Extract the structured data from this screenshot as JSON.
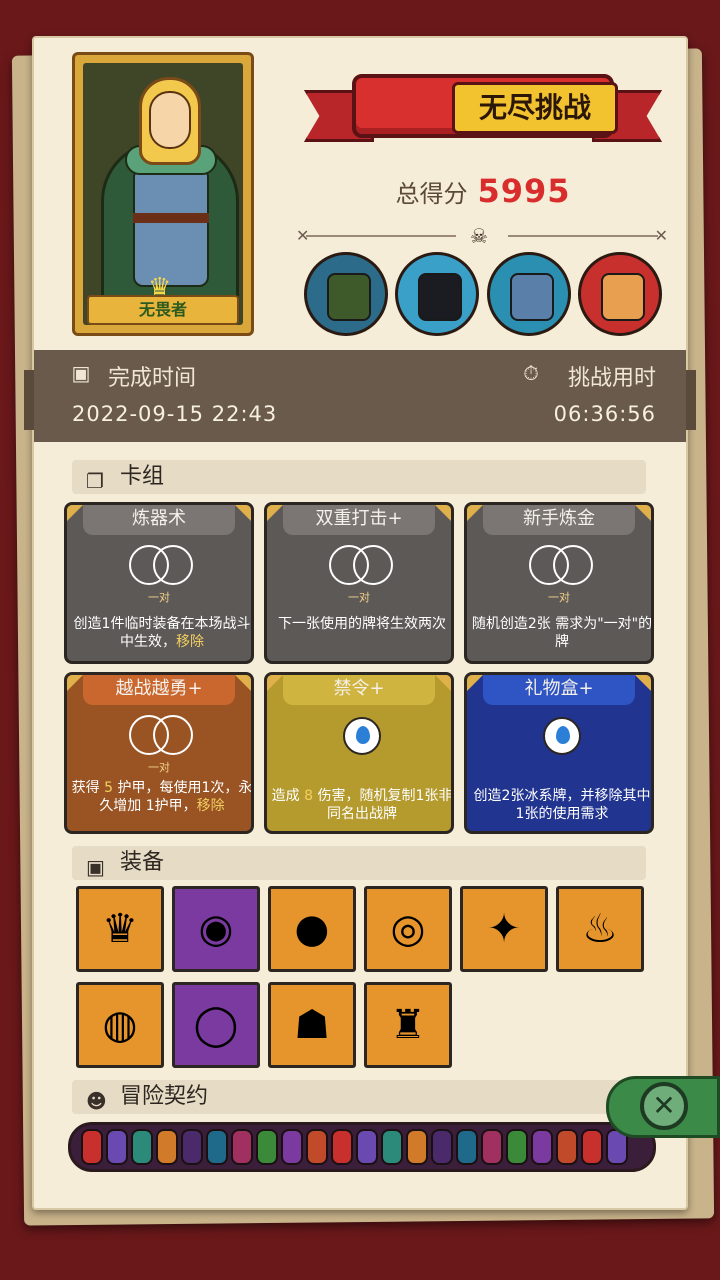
{
  "hero": {
    "name": "无畏者"
  },
  "title": {
    "label": "无尽挑战"
  },
  "score": {
    "label": "总得分",
    "value": "5995"
  },
  "stats": {
    "complete_label": "完成时间",
    "complete_value": "2022-09-15 22:43",
    "duration_label": "挑战用时",
    "duration_value": "06:36:56"
  },
  "bosses": [
    "green-helmet-knight",
    "shadow-beast",
    "blue-armored-knight",
    "red-hat-jester"
  ],
  "deck": {
    "header": "卡组",
    "pair_label": "一对",
    "cards": [
      {
        "title": "炼器术",
        "style": "gray",
        "icon": "pair",
        "desc_a": "创造1件临时装备在本场战斗中生效，",
        "desc_hl": "移除",
        "desc_b": ""
      },
      {
        "title": "双重打击+",
        "style": "gray",
        "icon": "pair",
        "desc_a": "下一张使用的牌将生效两次",
        "desc_hl": "",
        "desc_b": ""
      },
      {
        "title": "新手炼金",
        "style": "gray",
        "icon": "pair",
        "desc_a": "随机创造2张 需求为\"一对\"的牌",
        "desc_hl": "",
        "desc_b": ""
      },
      {
        "title": "越战越勇+",
        "style": "orange",
        "icon": "pair",
        "desc_a": "获得 ",
        "desc_hl": "5",
        "desc_b": " 护甲，每使用1次，永久增加 1护甲，",
        "desc_c": "移除"
      },
      {
        "title": "禁令+",
        "style": "olive",
        "icon": "drop",
        "desc_a": "造成 ",
        "desc_hl": "8",
        "desc_b": " 伤害，随机复制1张非同名出战牌"
      },
      {
        "title": "礼物盒+",
        "style": "blue",
        "icon": "drop",
        "desc_a": "创造2张冰系牌，并移除其中1张的使用需求",
        "desc_hl": "",
        "desc_b": ""
      }
    ]
  },
  "equipment": {
    "header": "装备",
    "items": [
      {
        "name": "crown-icon",
        "glyph": "♛",
        "bg": "or"
      },
      {
        "name": "wooden-button-icon",
        "glyph": "◉",
        "bg": "pu"
      },
      {
        "name": "blue-slime-icon",
        "glyph": "●",
        "bg": "or"
      },
      {
        "name": "eye-orb-icon",
        "glyph": "◎",
        "bg": "or"
      },
      {
        "name": "spiked-gauntlet-icon",
        "glyph": "✦",
        "bg": "or"
      },
      {
        "name": "meat-leg-icon",
        "glyph": "♨",
        "bg": "or"
      },
      {
        "name": "red-pan-icon",
        "glyph": "◍",
        "bg": "or"
      },
      {
        "name": "mirror-icon",
        "glyph": "◯",
        "bg": "pu"
      },
      {
        "name": "tribal-mask-icon",
        "glyph": "☗",
        "bg": "or"
      },
      {
        "name": "coin-bag-icon",
        "glyph": "♜",
        "bg": "or"
      }
    ]
  },
  "contract": {
    "header": "冒险契约"
  },
  "colors": {
    "accent_red": "#d92c2c",
    "paper": "#f6edd8",
    "stats_bar": "#6a5a4c"
  }
}
